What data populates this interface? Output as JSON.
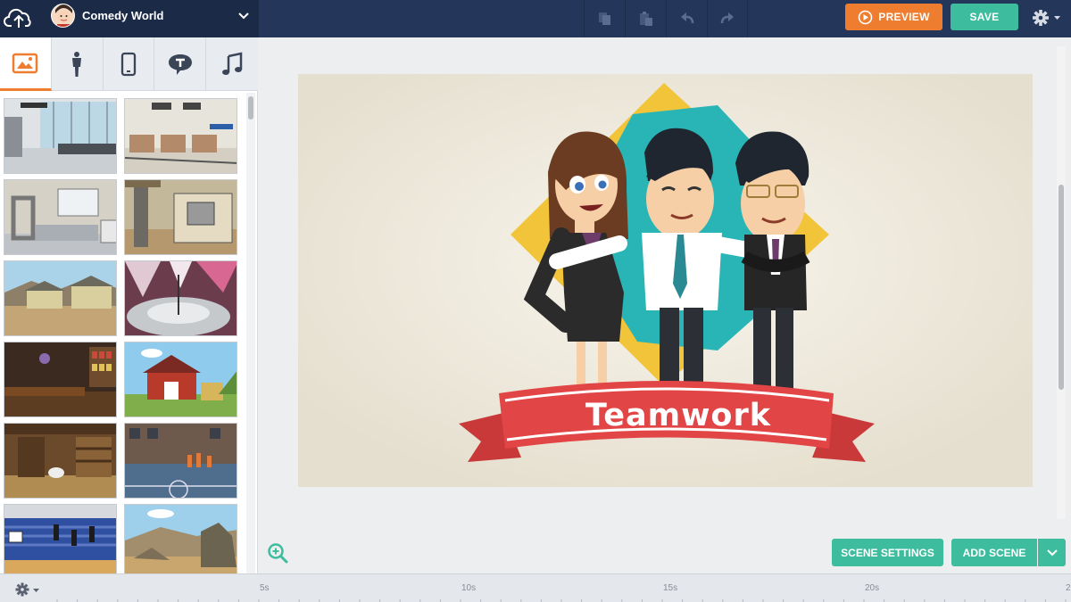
{
  "header": {
    "theme_name": "Comedy World",
    "toolbar_icons": [
      "copy-icon",
      "paste-icon",
      "undo-icon",
      "redo-icon"
    ],
    "preview_label": "PREVIEW",
    "save_label": "SAVE",
    "accent_orange": "#ef7d2f",
    "accent_green": "#3dbd9e"
  },
  "library": {
    "tabs": [
      {
        "name": "backgrounds",
        "icon": "image-icon",
        "active": true
      },
      {
        "name": "characters",
        "icon": "person-icon",
        "active": false
      },
      {
        "name": "props",
        "icon": "phone-icon",
        "active": false
      },
      {
        "name": "text",
        "icon": "speech-bubble-icon",
        "active": false
      },
      {
        "name": "audio",
        "icon": "music-note-icon",
        "active": false
      }
    ],
    "thumbnails": [
      "airport-lounge",
      "airport-checkin",
      "security-checkpoint",
      "construction-site",
      "farm-village",
      "talk-show-stage",
      "bar-interior",
      "red-barn",
      "barn-interior",
      "basketball-court-outdoor",
      "basketball-gym",
      "rocky-desert"
    ]
  },
  "scene": {
    "banner_text": "Teamwork"
  },
  "canvas_controls": {
    "scene_settings_label": "SCENE SETTINGS",
    "add_scene_label": "ADD SCENE"
  },
  "timeline": {
    "ticks": [
      "5s",
      "10s",
      "15s",
      "20s",
      "2"
    ]
  }
}
